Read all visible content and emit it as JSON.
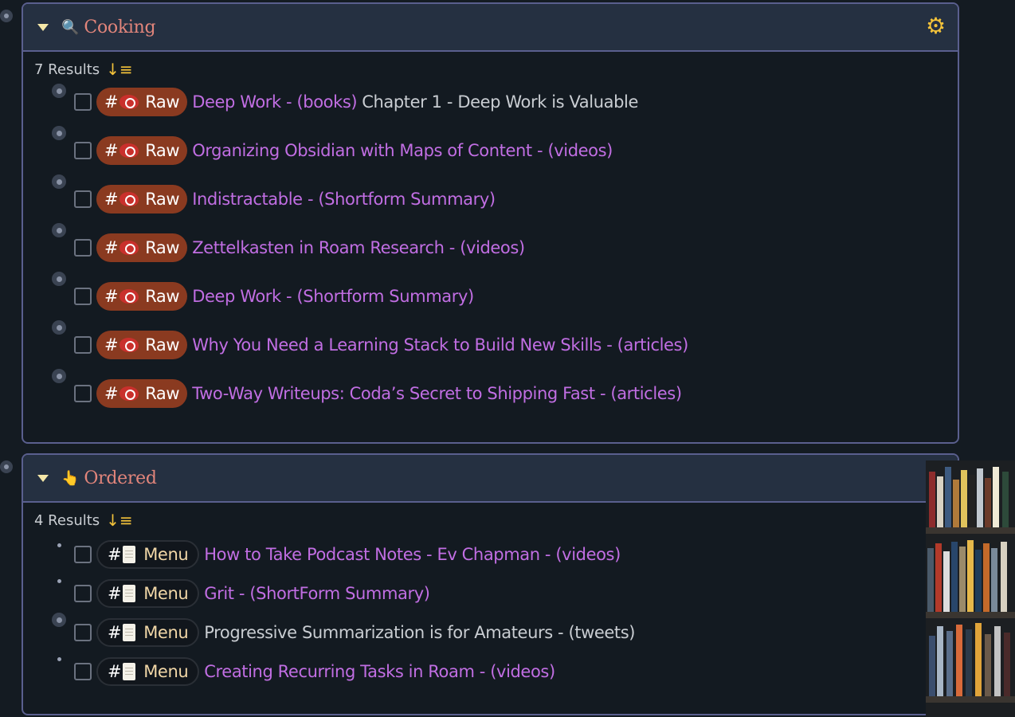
{
  "sections": [
    {
      "icon": "magnifier-icon",
      "title": "Cooking",
      "results_label": "7 Results",
      "tag_hash": "#",
      "tag_label": "Raw",
      "rows": [
        {
          "link": "Deep Work - (books)",
          "rest": "Chapter 1 - Deep Work is Valuable"
        },
        {
          "link": "Organizing Obsidian with Maps of Content - (videos)",
          "rest": ""
        },
        {
          "link": "Indistractable - (Shortform Summary)",
          "rest": ""
        },
        {
          "link": "Zettelkasten in Roam Research - (videos)",
          "rest": ""
        },
        {
          "link": "Deep Work - (Shortform Summary)",
          "rest": ""
        },
        {
          "link": "Why You Need a Learning Stack to Build New Skills - (articles)",
          "rest": ""
        },
        {
          "link": "Two-Way Writeups: Coda’s Secret to Shipping Fast - (articles)",
          "rest": ""
        }
      ]
    },
    {
      "icon": "pointing-hand-icon",
      "title": "Ordered",
      "results_label": "4 Results",
      "tag_hash": "#",
      "tag_label": "Menu",
      "rows": [
        {
          "link": "How to Take Podcast Notes - Ev Chapman - (videos)",
          "rest": ""
        },
        {
          "link": "Grit - (ShortForm Summary)",
          "rest": ""
        },
        {
          "link": "",
          "rest": "Progressive Summarization is for Amateurs - (tweets)"
        },
        {
          "link": "Creating Recurring Tasks in Roam - (videos)",
          "rest": ""
        }
      ]
    }
  ],
  "colors": {
    "link": "#c16ee3",
    "section_title": "#e2857b",
    "raw_tag_bg": "#8a3a20",
    "menu_tag_text": "#f1d7a7",
    "panel_border": "#5a5f8e",
    "gear": "#f3c23a"
  }
}
